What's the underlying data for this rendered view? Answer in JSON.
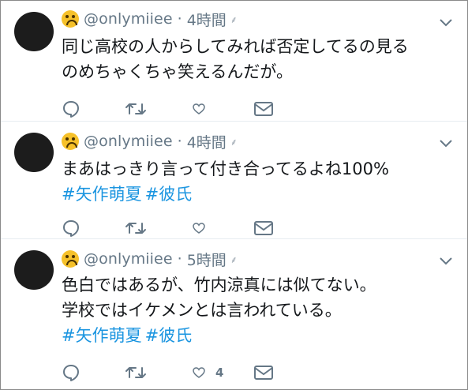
{
  "tweets": [
    {
      "handle": "@onlymiiee",
      "separator": "·",
      "time": "4時間",
      "lines": [
        "同じ高校の人からしてみれば否定してるの見る",
        "のめちゃくちゃ笑えるんだが。"
      ],
      "hashtags": [],
      "like_count": ""
    },
    {
      "handle": "@onlymiiee",
      "separator": "·",
      "time": "4時間",
      "lines": [
        "まあはっきり言って付き合ってるよね100%"
      ],
      "hashtags": [
        "#矢作萌夏",
        "#彼氏"
      ],
      "like_count": ""
    },
    {
      "handle": "@onlymiiee",
      "separator": "·",
      "time": "5時間",
      "lines": [
        "色白ではあるが、竹内涼真には似てない。",
        "学校ではイケメンとは言われている。"
      ],
      "hashtags": [
        "#矢作萌夏",
        "#彼氏"
      ],
      "like_count": "4"
    }
  ],
  "icons": {
    "avatar": "avatar",
    "emoji": "upside-down-face-emoji",
    "pin": "pin-icon",
    "more": "chevron-down-icon",
    "reply": "reply-icon",
    "retweet": "retweet-icon",
    "like": "heart-icon",
    "dm": "envelope-icon"
  },
  "colors": {
    "text": "#14171a",
    "muted": "#657786",
    "hashtag": "#1b95e0",
    "divider": "#e6ecf0",
    "avatar": "#1c1c1c",
    "emoji": "#f6c12a"
  }
}
